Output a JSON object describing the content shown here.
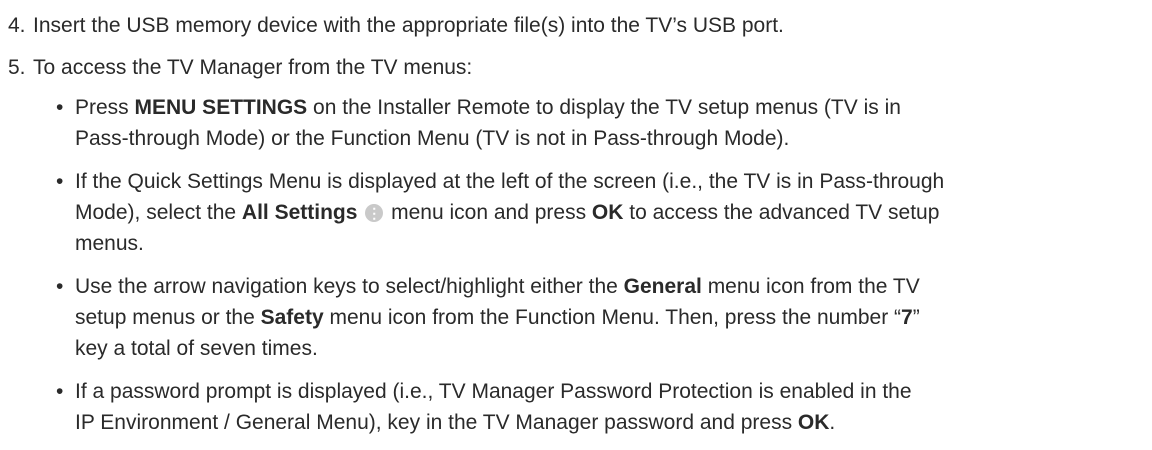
{
  "steps": [
    {
      "number": "4.",
      "text": "Insert the USB memory device with the appropriate file(s) into the TV’s USB port."
    },
    {
      "number": "5.",
      "text": "To access the TV Manager from the TV menus:"
    }
  ],
  "bullet_glyph": "•",
  "b1": {
    "pre": "Press ",
    "bold1": "MENU SETTINGS",
    "mid": " on the Installer Remote to display the TV setup menus (TV is in",
    "line2": "Pass-through Mode) or the Function Menu (TV is not in Pass-through Mode)."
  },
  "b2": {
    "line1": "If the Quick Settings Menu is displayed at the left of the screen (i.e., the TV is in Pass-through",
    "pre2": "Mode), select the ",
    "bold1": "All Settings",
    "icon_glyph": "⋮",
    "mid2": " menu icon and press ",
    "bold2": "OK",
    "post2": " to access the advanced TV setup",
    "line3": "menus."
  },
  "b3": {
    "pre1": "Use the arrow navigation keys to select/highlight either the ",
    "bold1": "General",
    "post1": " menu icon from the TV",
    "pre2": "setup menus or the ",
    "bold2": "Safety",
    "mid2": " menu icon from the Function Menu. Then, press the number “",
    "bold3": "7",
    "post2": "”",
    "line3": "key a total of seven times."
  },
  "b4": {
    "line1": "If a password prompt is displayed (i.e., TV Manager Password Protection is enabled in the",
    "pre2": "IP Environment / General Menu), key in the TV Manager password and press ",
    "bold2": "OK",
    "post2": "."
  }
}
